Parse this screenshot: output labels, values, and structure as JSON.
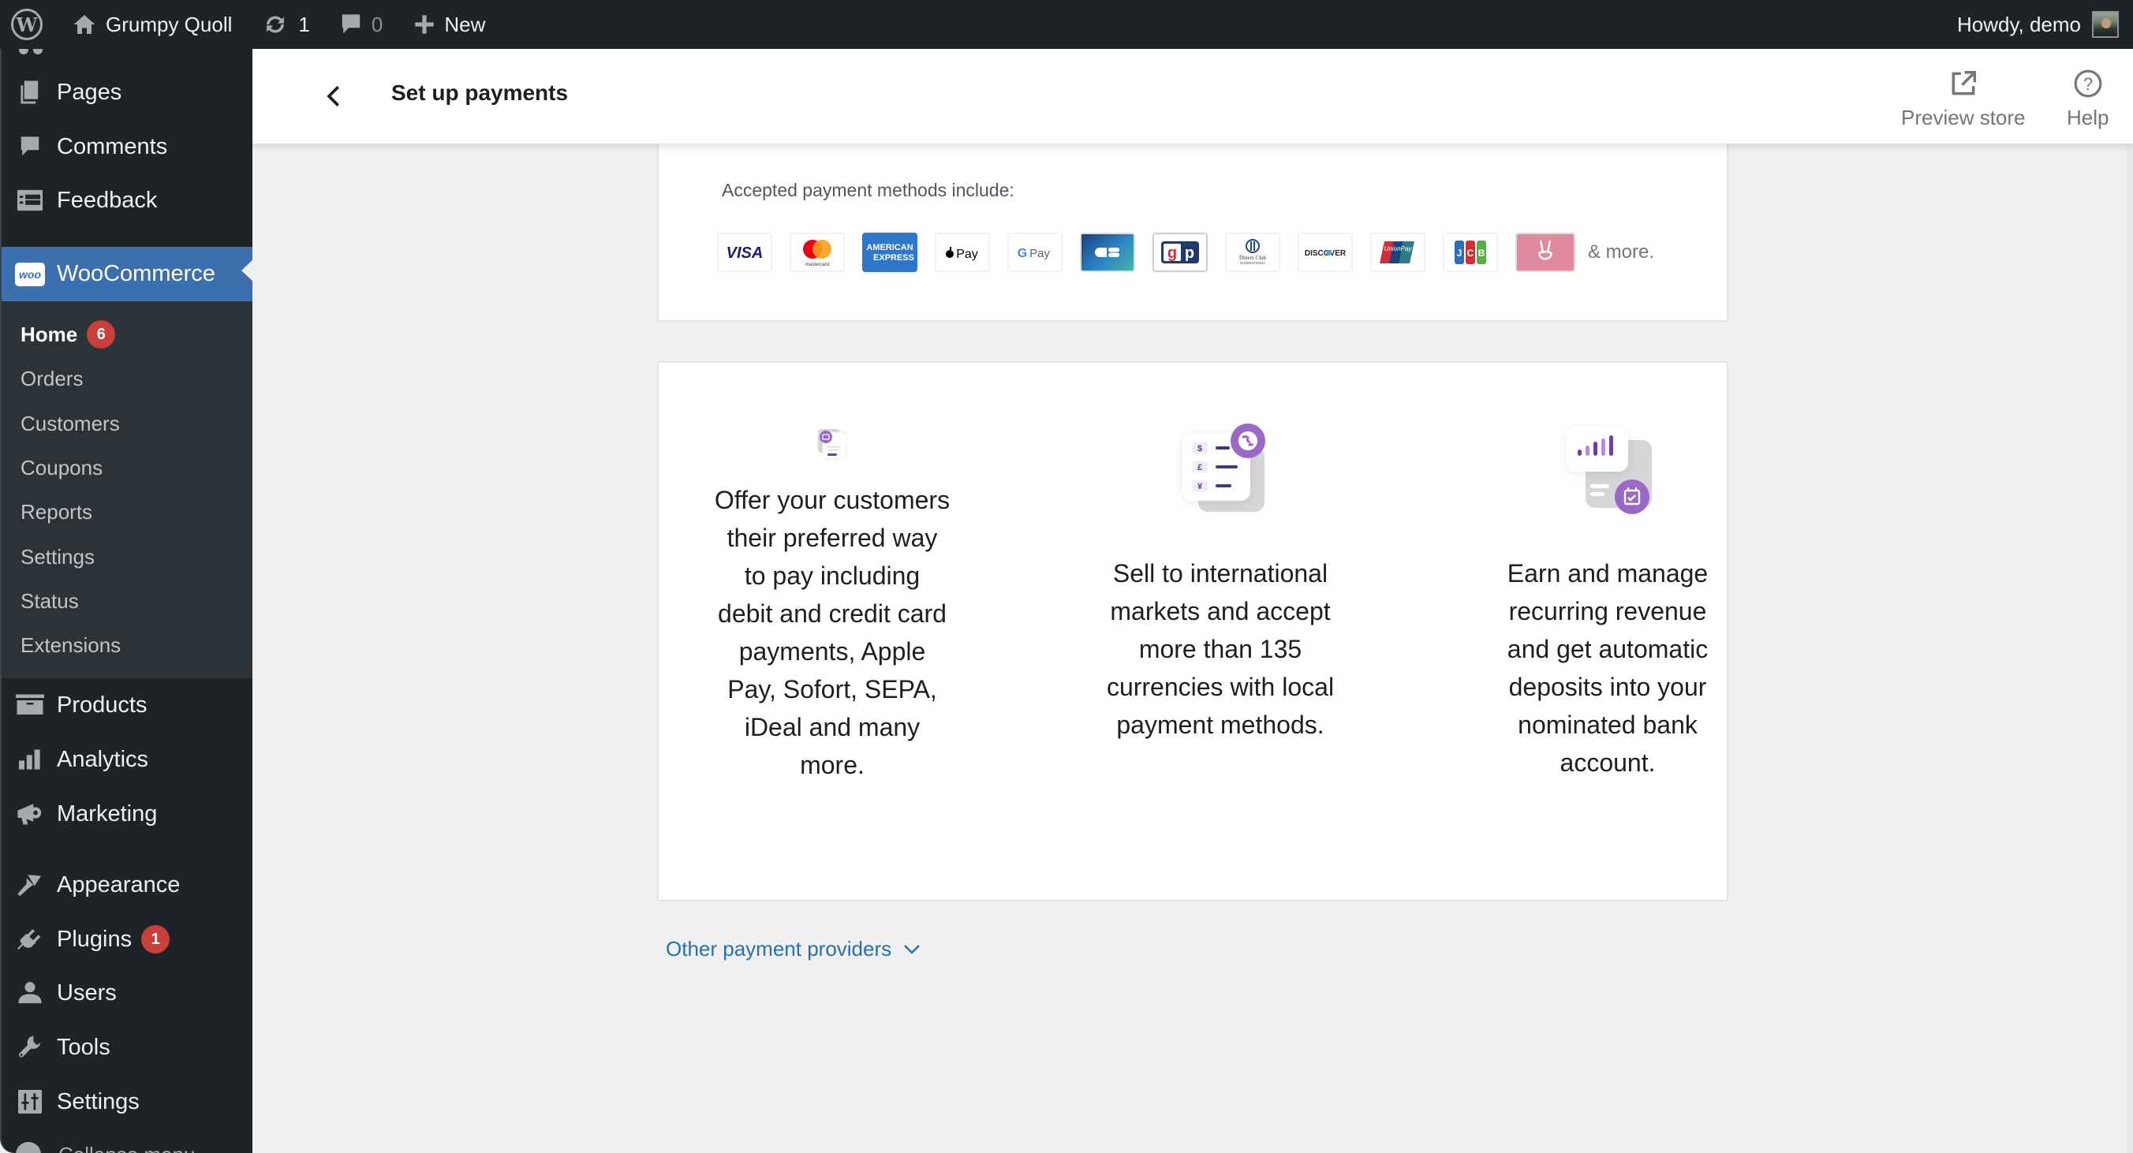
{
  "adminbar": {
    "site_name": "Grumpy Quoll",
    "updates_count": "1",
    "comments_count": "0",
    "new_label": "New",
    "greeting": "Howdy, demo",
    "icons": {
      "wp": "wordpress-logo-icon",
      "home": "home-icon",
      "updates": "refresh-icon",
      "comments": "comment-icon",
      "new": "plus-icon"
    }
  },
  "sidebar": {
    "top_items": [
      {
        "label": "Pages",
        "icon": "pages-icon"
      },
      {
        "label": "Comments",
        "icon": "comments-icon"
      },
      {
        "label": "Feedback",
        "icon": "feedback-icon"
      }
    ],
    "woocommerce": {
      "label": "WooCommerce",
      "icon_text": "woo"
    },
    "submenu": [
      {
        "label": "Home",
        "badge": "6",
        "current": true
      },
      {
        "label": "Orders"
      },
      {
        "label": "Customers"
      },
      {
        "label": "Coupons"
      },
      {
        "label": "Reports"
      },
      {
        "label": "Settings"
      },
      {
        "label": "Status"
      },
      {
        "label": "Extensions"
      }
    ],
    "bottom_items": [
      {
        "label": "Products",
        "icon": "products-icon"
      },
      {
        "label": "Analytics",
        "icon": "analytics-icon"
      },
      {
        "label": "Marketing",
        "icon": "megaphone-icon"
      },
      {
        "label": "Appearance",
        "icon": "paintbrush-icon"
      },
      {
        "label": "Plugins",
        "icon": "plugin-icon",
        "badge": "1"
      },
      {
        "label": "Users",
        "icon": "user-icon"
      },
      {
        "label": "Tools",
        "icon": "wrench-icon"
      },
      {
        "label": "Settings",
        "icon": "settings-icon"
      }
    ],
    "collapse_label": "Collapse menu"
  },
  "header": {
    "title": "Set up payments",
    "preview_label": "Preview store",
    "help_label": "Help"
  },
  "payments": {
    "accepted_label": "Accepted payment methods include:",
    "methods": [
      "Visa",
      "Mastercard",
      "American Express",
      "Apple Pay",
      "Google Pay",
      "Cartes Bancaires",
      "giropay",
      "Diners Club",
      "Discover",
      "UnionPay",
      "JCB",
      "Klarna-style (peace sign)"
    ],
    "more_label": "& more.",
    "features": [
      {
        "text": "Offer your customers their preferred way to pay including debit and credit card payments, Apple Pay, Sofort, SEPA, iDeal and many more.",
        "icon": "payment-card-illustration"
      },
      {
        "text": "Sell to international markets and accept more than 135 currencies with local payment methods.",
        "icon": "currencies-globe-illustration"
      },
      {
        "text": "Earn and manage recurring revenue and get automatic deposits into your nominated bank account.",
        "icon": "recurring-revenue-illustration"
      }
    ],
    "other_providers_label": "Other payment providers"
  },
  "colors": {
    "admin_dark": "#1d2327",
    "woo_active": "#3c6fae",
    "submenu_bg": "#2c3338",
    "badge_red": "#c9403b",
    "link_blue": "#2271b1",
    "accent_purple": "#9a69c7"
  }
}
